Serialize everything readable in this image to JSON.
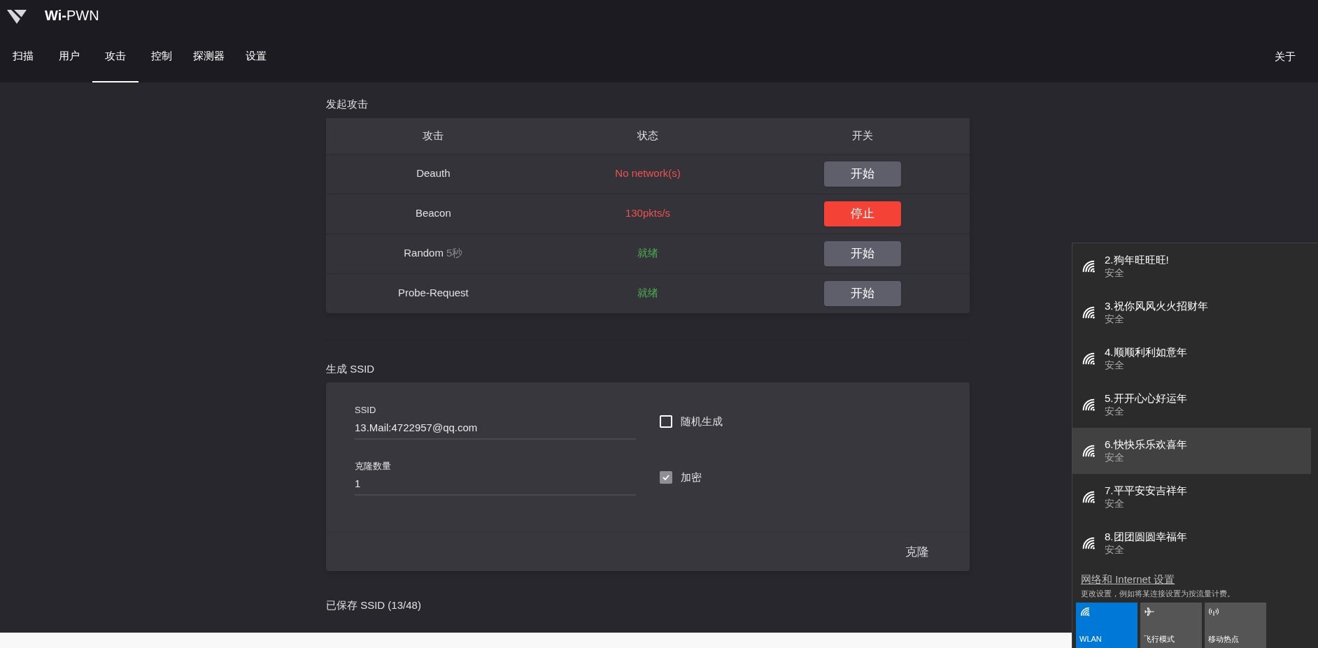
{
  "app": {
    "title_bold": "Wi-",
    "title_rest": "PWN"
  },
  "tabs": [
    {
      "label": "扫描",
      "selected": false
    },
    {
      "label": "用户",
      "selected": false
    },
    {
      "label": "攻击",
      "selected": true
    },
    {
      "label": "控制",
      "selected": false
    },
    {
      "label": "探测器",
      "selected": false
    },
    {
      "label": "设置",
      "selected": false
    }
  ],
  "about": "关于",
  "attack_section": {
    "title": "发起攻击",
    "columns": [
      "攻击",
      "状态",
      "开关"
    ],
    "rows": [
      {
        "name": "Deauth",
        "status": "No network(s)",
        "color": "#f0524f",
        "running": false,
        "button": "开始"
      },
      {
        "name": "Beacon",
        "status": "130pkts/s",
        "color": "#f0524f",
        "running": true,
        "button": "停止"
      },
      {
        "name": "Random",
        "note": "5秒",
        "status": "就绪",
        "color": "#4caf50",
        "running": false,
        "button": "开始"
      },
      {
        "name": "Probe-Request",
        "status": "就绪",
        "color": "#4caf50",
        "running": false,
        "button": "开始"
      }
    ]
  },
  "ssid_section": {
    "title": "生成 SSID",
    "fields": [
      {
        "label": "SSID",
        "value": "13.Mail:4722957@qq.com",
        "option": "随机生成",
        "checked": false
      },
      {
        "label": "克隆数量",
        "value": "1",
        "option": "加密",
        "checked": true
      }
    ],
    "button": "克隆"
  },
  "saved_title": "已保存 SSID (13/48)",
  "wifi_flyout": {
    "networks": [
      {
        "name": "2.狗年旺旺旺!",
        "security": "安全",
        "selected": false
      },
      {
        "name": "3.祝你风风火火招财年",
        "security": "安全",
        "selected": false
      },
      {
        "name": "4.顺顺利利如意年",
        "security": "安全",
        "selected": false
      },
      {
        "name": "5.开开心心好运年",
        "security": "安全",
        "selected": false
      },
      {
        "name": "6.快快乐乐欢喜年",
        "security": "安全",
        "selected": true
      },
      {
        "name": "7.平平安安吉祥年",
        "security": "安全",
        "selected": false
      },
      {
        "name": "8.团团圆圆幸福年",
        "security": "安全",
        "selected": false
      }
    ],
    "settings_link": "网络和 Internet 设置",
    "settings_hint": "更改设置，例如将某连接设置为按流量计费。",
    "tiles": [
      {
        "kind": "wifi",
        "label": "WLAN",
        "on": true
      },
      {
        "kind": "plane",
        "label": "飞行模式",
        "on": false
      },
      {
        "kind": "hotspot",
        "label": "移动热点",
        "on": false
      }
    ]
  }
}
